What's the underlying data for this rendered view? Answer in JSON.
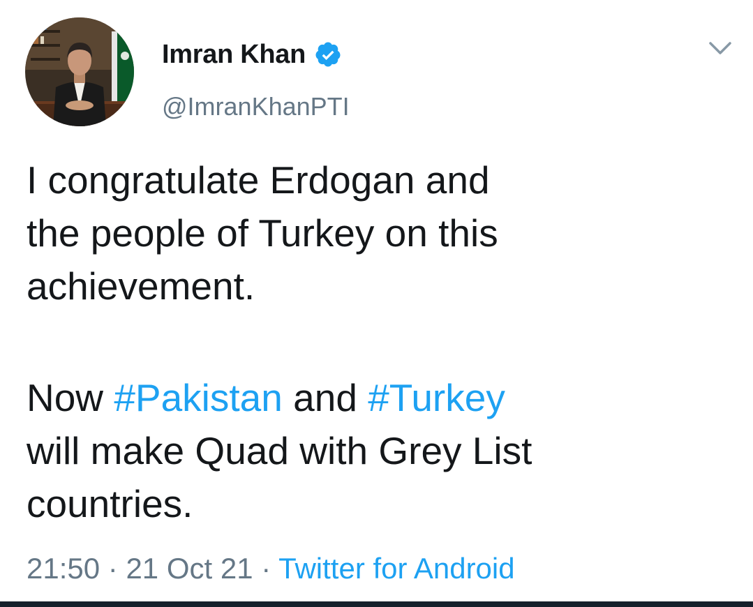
{
  "author": {
    "name": "Imran Khan",
    "handle": "@ImranKhanPTI",
    "verified": true,
    "verified_color": "#1da1f2"
  },
  "tweet": {
    "paragraph1": {
      "lines": [
        "I congratulate Erdogan and",
        "the people of Turkey on this",
        "achievement."
      ]
    },
    "paragraph2": {
      "line1_before": "Now ",
      "hashtag1": "#Pakistan",
      "line1_middle": " and ",
      "hashtag2": "#Turkey",
      "lines_rest": [
        "will make Quad with Grey List",
        "countries."
      ]
    }
  },
  "meta": {
    "time": "21:50",
    "separator": " · ",
    "date": "21 Oct 21",
    "source": "Twitter for Android"
  },
  "icons": {
    "menu": "chevron-down-icon",
    "verified": "verified-badge-icon",
    "avatar": "profile-photo"
  },
  "colors": {
    "text": "#14171a",
    "secondary": "#657786",
    "link": "#1da1f2",
    "bottom_bar": "#15202b"
  }
}
